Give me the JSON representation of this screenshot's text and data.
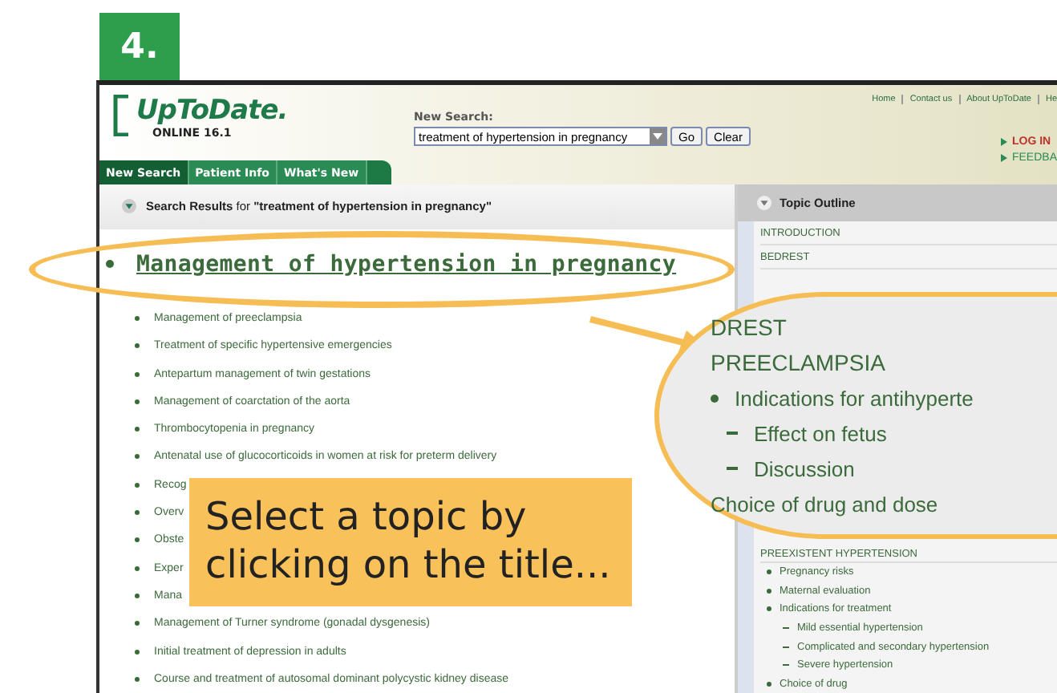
{
  "figure_number": "4.",
  "header": {
    "logo": "UpToDate.",
    "edition": "ONLINE 16.1",
    "search_label": "New Search:",
    "search": {
      "value": "treatment of hypertension in pregnancy"
    },
    "buttons": [
      "Go",
      "Clear"
    ],
    "top_links": [
      "Home",
      "Contact us",
      "About UpToDate",
      "He"
    ],
    "side_links": [
      {
        "label": "LOG IN",
        "kind": "login"
      },
      {
        "label": "FEEDBA",
        "kind": "feedback"
      }
    ]
  },
  "tabs": [
    {
      "label": "New Search",
      "selected": true
    },
    {
      "label": "Patient Info",
      "selected": false
    },
    {
      "label": "What's New",
      "selected": false
    }
  ],
  "results": {
    "heading": "**Search Results** for **\"treatment of hypertension in pregnancy\"**",
    "top_result": "Management of hypertension in pregnancy",
    "items": [
      "Management of preeclampsia",
      "Treatment of specific hypertensive emergencies",
      "Antepartum management of twin gestations",
      "Management of coarctation of the aorta",
      "Thrombocytopenia in pregnancy",
      "Antenatal use of glucocorticoids in women at risk for preterm delivery",
      "Recog",
      "Overv",
      "Obste",
      "Exper",
      "Mana",
      "Management of Turner syndrome (gonadal dysgenesis)",
      "Initial treatment of depression in adults",
      "Course and treatment of autosomal dominant polycystic kidney disease"
    ]
  },
  "outline": {
    "title": "Topic Outline",
    "items": [
      "INTRODUCTION",
      "BEDREST"
    ],
    "magnified": [
      {
        "kind": "heading",
        "text": "DREST"
      },
      {
        "kind": "heading",
        "text": "PREECLAMPSIA"
      },
      {
        "kind": "bullet",
        "text": "Indications for antihyperte"
      },
      {
        "kind": "sub",
        "text": "Effect on fetus"
      },
      {
        "kind": "sub",
        "text": "Discussion"
      },
      {
        "kind": "plain",
        "text": "Choice of drug and dose"
      }
    ],
    "section": {
      "heading": "PREEXISTENT HYPERTENSION",
      "items": [
        {
          "text": "Pregnancy risks"
        },
        {
          "text": "Maternal evaluation"
        },
        {
          "text": "Indications for treatment",
          "children": [
            {
              "text": "Mild essential hypertension"
            },
            {
              "text": "Complicated and secondary hypertension"
            },
            {
              "text": "Severe hypertension"
            }
          ]
        },
        {
          "text": "Choice of drug"
        }
      ]
    }
  },
  "callout": {
    "text": "Select a topic by clicking on the title..."
  }
}
